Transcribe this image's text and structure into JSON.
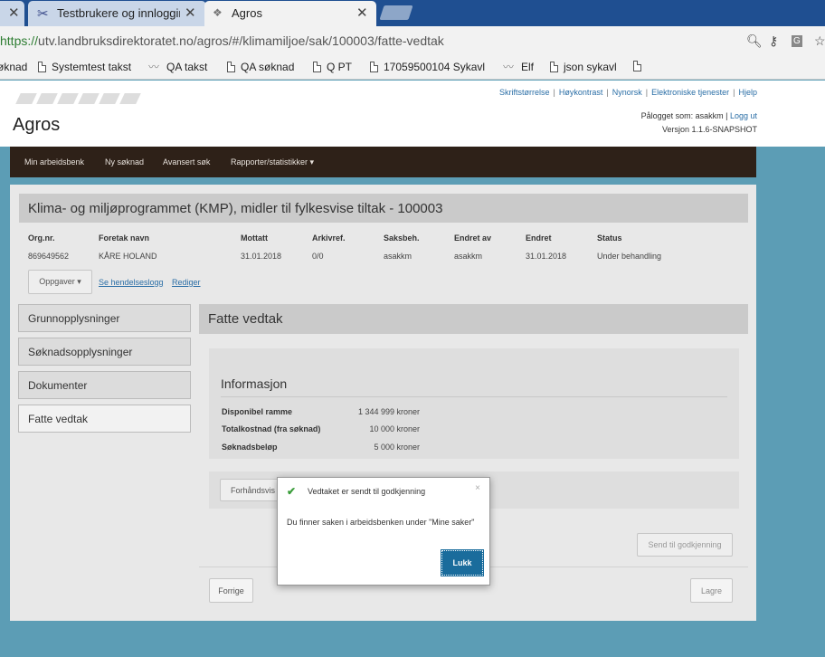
{
  "browser": {
    "tabs": [
      {
        "title": "",
        "close": "✕"
      },
      {
        "title": "Testbrukere og innlogging",
        "close": "✕"
      },
      {
        "title": "Agros",
        "close": "✕"
      }
    ],
    "url_scheme": "https://",
    "url_rest": "utv.landbruksdirektoratet.no/agros/#/klimamiljoe/sak/100003/fatte-vedtak",
    "bookmarks": [
      "øknad",
      "Systemtest takst",
      "QA takst",
      "QA søknad",
      "Q PT",
      "17059500104 Sykavl",
      "Elf",
      "json sykavl",
      ""
    ]
  },
  "header": {
    "logo": "Agros",
    "links": [
      "Skriftstørrelse",
      "Høykontrast",
      "Nynorsk",
      "Elektroniske tjenester",
      "Hjelp"
    ],
    "logged_in_label": "Pålogget som: asakkm",
    "logout": "Logg ut",
    "version": "Versjon 1.1.6-SNAPSHOT"
  },
  "nav": {
    "items": [
      "Min arbeidsbenk",
      "Ny søknad",
      "Avansert søk",
      "Rapporter/statistikker ▾"
    ]
  },
  "case": {
    "title": "Klima- og miljøprogrammet (KMP), midler til fylkesvise tiltak - 100003",
    "columns": [
      {
        "header": "Org.nr.",
        "value": "869649562"
      },
      {
        "header": "Foretak navn",
        "value": "KÅRE HOLAND"
      },
      {
        "header": "Mottatt",
        "value": "31.01.2018"
      },
      {
        "header": "Arkivref.",
        "value": "0/0"
      },
      {
        "header": "Saksbeh.",
        "value": "asakkm"
      },
      {
        "header": "Endret av",
        "value": "asakkm"
      },
      {
        "header": "Endret",
        "value": "31.01.2018"
      },
      {
        "header": "Status",
        "value": "Under behandling"
      }
    ],
    "tasks_button": "Oppgaver ▾",
    "event_log_link": "Se hendelseslogg",
    "edit_link": "Rediger"
  },
  "sidenav": [
    "Grunnopplysninger",
    "Søknadsopplysninger",
    "Dokumenter",
    "Fatte vedtak"
  ],
  "content": {
    "title": "Fatte vedtak",
    "info_title": "Informasjon",
    "rows": [
      {
        "label": "Disponibel ramme",
        "value": "1 344 999 kroner"
      },
      {
        "label": "Totalkostnad (fra søknad)",
        "value": "10 000 kroner"
      },
      {
        "label": "Søknadsbeløp",
        "value": "5 000 kroner"
      }
    ],
    "preview_button": "Forhåndsvis",
    "send_button": "Send til godkjenning",
    "prev_button": "Forrige",
    "save_button": "Lagre"
  },
  "modal": {
    "title": "Vedtaket er sendt til godkjenning",
    "close": "×",
    "body": "Du finner saken i arbeidsbenken under \"Mine saker\"",
    "ok": "Lukk"
  }
}
